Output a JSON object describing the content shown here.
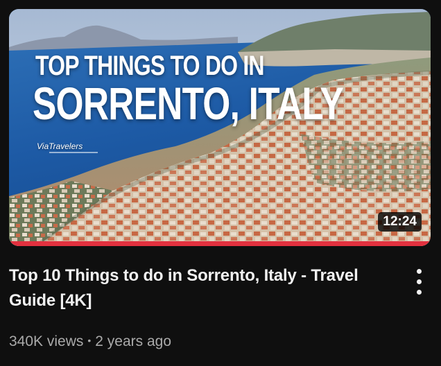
{
  "video": {
    "thumbnail": {
      "overlay_line1": "TOP THINGS TO DO IN",
      "overlay_line2": "SORRENTO, ITALY",
      "channel_logo": "ViaTravelers",
      "duration": "12:24",
      "watch_progress": 1.0,
      "progress_color": "#e2313f"
    },
    "title": "Top 10 Things to do in Sorrento, Italy - Travel Guide [4K]",
    "views": "340K views",
    "separator": "•",
    "age": "2 years ago",
    "menu_icon": "more-vert-icon"
  }
}
